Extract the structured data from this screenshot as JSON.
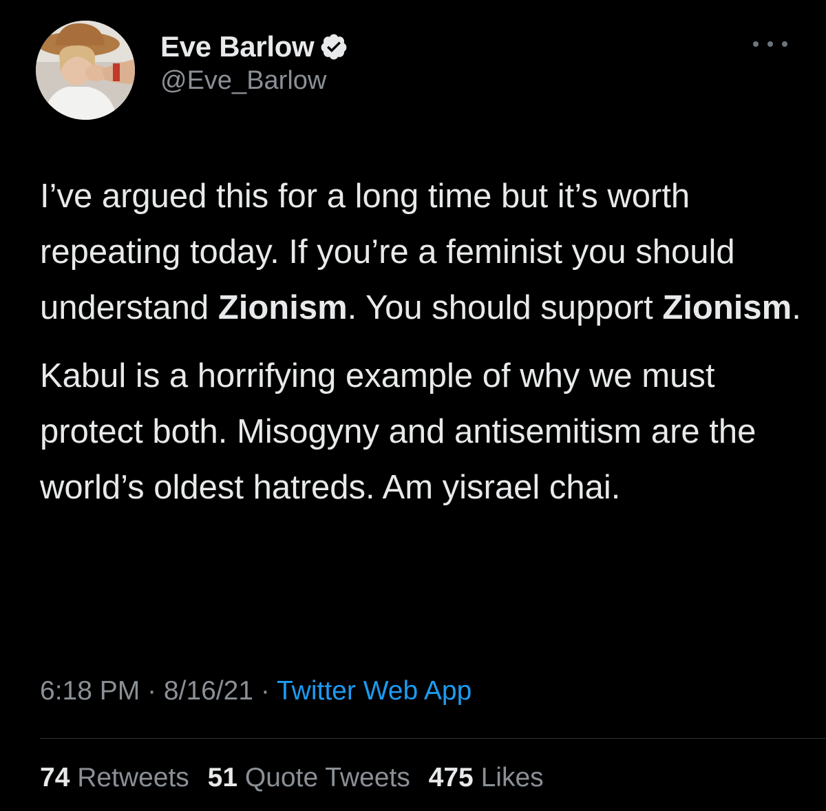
{
  "author": {
    "display_name": "Eve Barlow",
    "handle": "@Eve_Barlow",
    "verified": true,
    "avatar_icon": "profile-photo"
  },
  "tweet": {
    "paragraph1": {
      "part1": "I’ve argued this for a long time but it’s worth repeating today. If you’re a feminist you should understand ",
      "bold1": "Zionism",
      "part2": ". You should support ",
      "bold2": "Zionism",
      "part3": "."
    },
    "paragraph2": "Kabul is a horrifying example of why we must protect both. Misogyny and antisemitism are the world’s oldest hatreds. Am yisrael chai."
  },
  "meta": {
    "time": "6:18 PM",
    "separator": " · ",
    "date": "8/16/21",
    "source": "Twitter Web App"
  },
  "stats": {
    "retweets_count": "74",
    "retweets_label": "Retweets",
    "quotes_count": "51",
    "quotes_label": "Quote Tweets",
    "likes_count": "475",
    "likes_label": "Likes"
  },
  "colors": {
    "background": "#000000",
    "text": "#e7e9ea",
    "secondary": "#8b9096",
    "link": "#1d9bf0",
    "divider": "#2f3336"
  }
}
